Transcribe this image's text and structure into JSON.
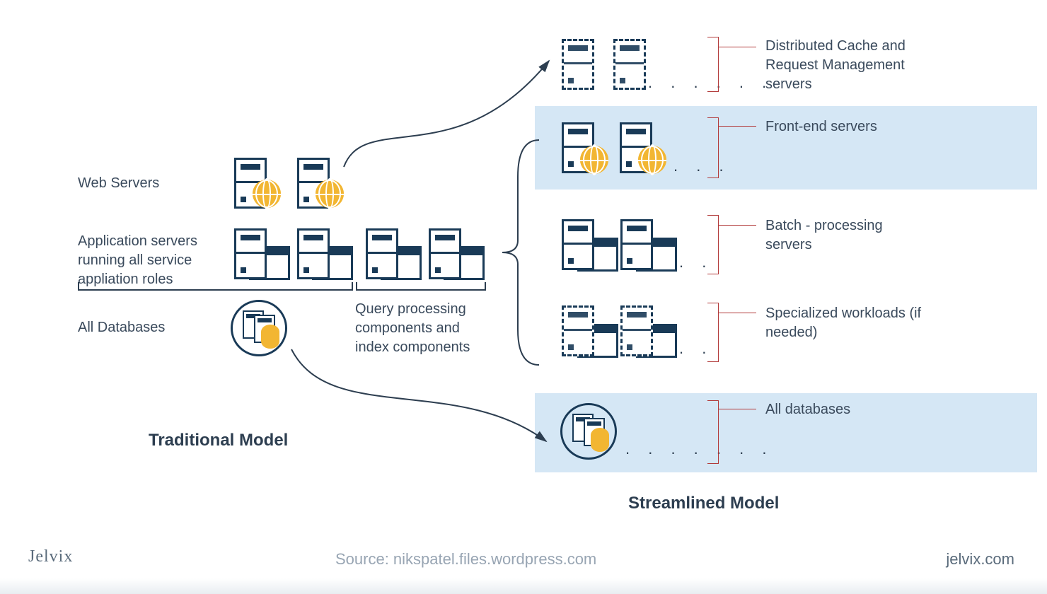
{
  "left": {
    "webServers": "Web Servers",
    "appServers": "Application servers running all service appliation roles",
    "allDatabases": "All Databases",
    "query": "Query processing components and index components",
    "title": "Traditional Model"
  },
  "right": {
    "distributed": "Distributed Cache and Request Management servers",
    "frontEnd": "Front-end servers",
    "batch": "Batch - processing servers",
    "specialized": "Specialized workloads (if needed)",
    "allDb": "All databases",
    "title": "Streamlined Model"
  },
  "footer": {
    "brand": "Jelvix",
    "source": "Source: nikspatel.files.wordpress.com",
    "url": "jelvix.com"
  },
  "chart_data": {
    "type": "comparison-diagram",
    "left_model": {
      "name": "Traditional Model",
      "tiers": [
        {
          "label": "Web Servers",
          "icon": "server-with-globe",
          "count": 2
        },
        {
          "label": "Application servers running all service application roles",
          "icon": "server-with-window",
          "count": 4,
          "sublabel": "Query processing components and index components"
        },
        {
          "label": "All Databases",
          "icon": "database-cluster",
          "count": 1
        }
      ]
    },
    "right_model": {
      "name": "Streamlined Model",
      "tiers": [
        {
          "label": "Distributed Cache and Request Management servers",
          "icon": "dashed-server",
          "count": "2+",
          "highlighted": false,
          "optional": true
        },
        {
          "label": "Front-end servers",
          "icon": "server-with-globe",
          "count": "2+",
          "highlighted": true
        },
        {
          "label": "Batch - processing servers",
          "icon": "server-with-window",
          "count": "2+",
          "highlighted": false
        },
        {
          "label": "Specialized workloads (if needed)",
          "icon": "dashed-server-with-window",
          "count": "2+",
          "highlighted": false,
          "optional": true
        },
        {
          "label": "All databases",
          "icon": "database-cluster",
          "count": "1+",
          "highlighted": true
        }
      ]
    },
    "arrows": [
      "Traditional Web Servers → Streamlined Distributed Cache",
      "Traditional All Databases → Streamlined All databases"
    ]
  }
}
